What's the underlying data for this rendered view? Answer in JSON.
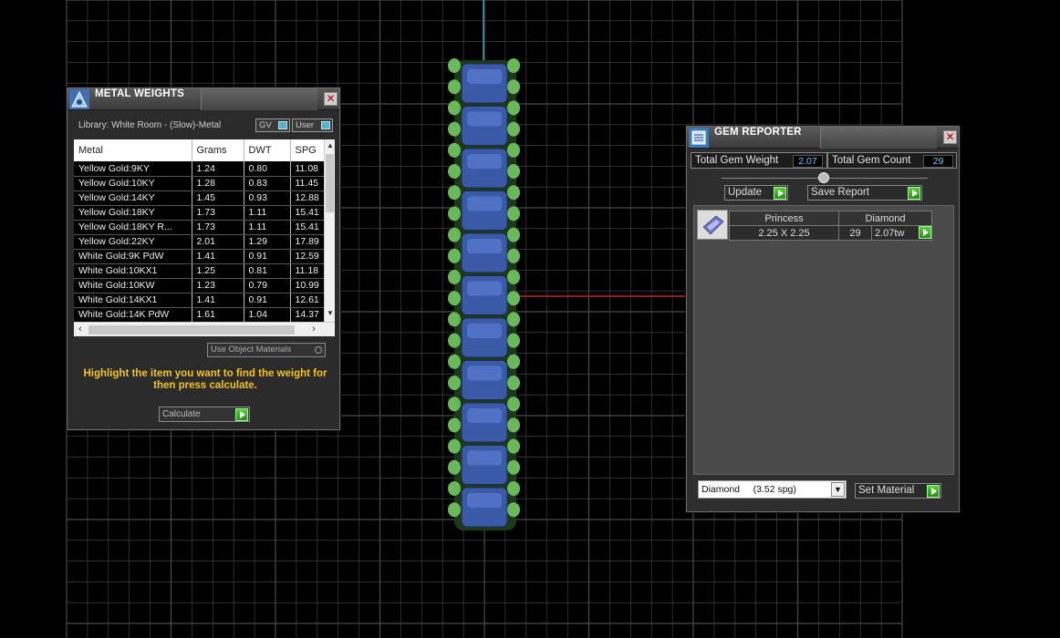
{
  "metal_weights": {
    "title": "METAL WEIGHTS",
    "library_label": "Library: White Room - (Slow)-Metal",
    "toggle_gv": "GV",
    "toggle_user": "User",
    "columns": [
      "Metal",
      "Grams",
      "DWT",
      "SPG"
    ],
    "rows": [
      [
        "Yellow Gold:9KY",
        "1.24",
        "0.80",
        "11.08"
      ],
      [
        "Yellow Gold:10KY",
        "1.28",
        "0.83",
        "11.45"
      ],
      [
        "Yellow Gold:14KY",
        "1.45",
        "0.93",
        "12.88"
      ],
      [
        "Yellow Gold:18KY",
        "1.73",
        "1.11",
        "15.41"
      ],
      [
        "Yellow Gold:18KY R...",
        "1.73",
        "1.11",
        "15.41"
      ],
      [
        "Yellow Gold:22KY",
        "2.01",
        "1.29",
        "17.89"
      ],
      [
        "White Gold:9K PdW",
        "1.41",
        "0.91",
        "12.59"
      ],
      [
        "White Gold:10KX1",
        "1.25",
        "0.81",
        "11.18"
      ],
      [
        "White Gold:10KW",
        "1.23",
        "0.79",
        "10.99"
      ],
      [
        "White Gold:14KX1",
        "1.41",
        "0.91",
        "12.61"
      ],
      [
        "White Gold:14K PdW",
        "1.61",
        "1.04",
        "14.37"
      ]
    ],
    "use_object_materials": "Use Object Materials",
    "hint": "Highlight the item you want to find the weight for then press calculate.",
    "calculate": "Calculate"
  },
  "gem_reporter": {
    "title": "GEM REPORTER",
    "total_weight_label": "Total Gem Weight",
    "total_weight_value": "2.07",
    "total_count_label": "Total Gem Count",
    "total_count_value": "29",
    "update": "Update",
    "save_report": "Save Report",
    "gem": {
      "cut": "Princess",
      "material": "Diamond",
      "size": "2.25 X 2.25",
      "count": "29",
      "weight": "2.07tw"
    },
    "material_select": "Diamond     (3.52 spg)",
    "set_material": "Set Material"
  },
  "colors": {
    "grid_line": "#4a4a4a",
    "axis_x": "#c0262b",
    "axis_y": "#3aa7b8",
    "prong_green": "#69b85a",
    "stone_blue": "#3a5aa8",
    "hint_yellow": "#f0c419",
    "value_blue": "#6cc9ff"
  }
}
